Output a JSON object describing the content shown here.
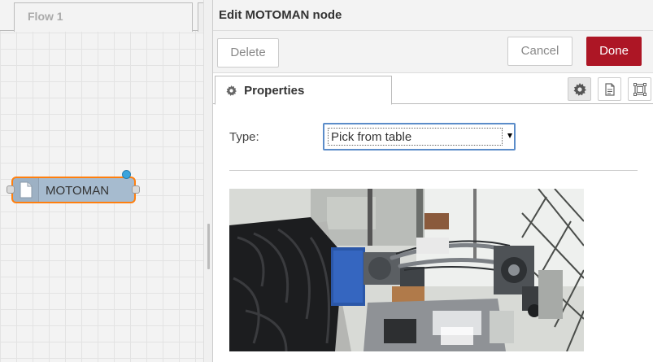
{
  "workspace": {
    "tab_label": "Flow 1",
    "node": {
      "label": "MOTOMAN",
      "icon": "file-icon",
      "color": "#a6bbcf",
      "selected_outline": "#ff7f0e"
    }
  },
  "tray": {
    "title": "Edit MOTOMAN node",
    "buttons": {
      "delete": "Delete",
      "cancel": "Cancel",
      "done": "Done"
    },
    "tabs": {
      "properties": "Properties"
    },
    "form": {
      "type_label": "Type:",
      "type_value": "Pick from table"
    }
  },
  "colors": {
    "done_button": "#ad1625",
    "status_dot": "#3ba4dd"
  }
}
